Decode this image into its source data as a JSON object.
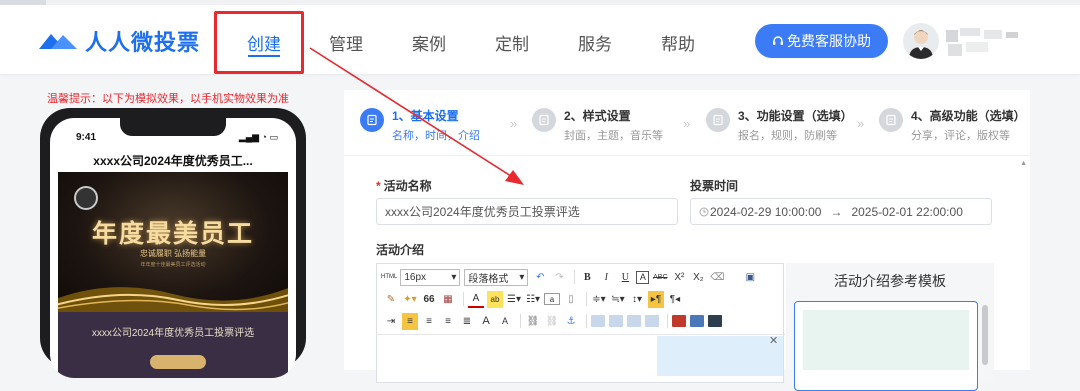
{
  "brand": {
    "logo_text": "人人微投票",
    "accent": "#1d6ff0"
  },
  "nav": [
    {
      "label": "创建",
      "active": true
    },
    {
      "label": "管理"
    },
    {
      "label": "案例"
    },
    {
      "label": "定制"
    },
    {
      "label": "服务"
    },
    {
      "label": "帮助"
    }
  ],
  "header": {
    "service_button": "免费客服协助",
    "avatar_icon": "person-avatar-icon"
  },
  "preview": {
    "tip": "温馨提示：以下为模拟效果，以手机实物效果为准",
    "time": "9:41",
    "status_icons": "▂▄▆ ◔ ▭",
    "title": "xxxx公司2024年度优秀员工...",
    "banner_title": "年度最美员工",
    "banner_sub": "忠诚履职  弘扬能量",
    "banner_tiny": "年年度十佳最美员工评选活动",
    "body_text": "xxxx公司2024年度优秀员工投票评选"
  },
  "steps": [
    {
      "title": "1、基本设置",
      "sub": "名称，时间，介绍",
      "active": true
    },
    {
      "title": "2、样式设置",
      "sub": "封面，主题，音乐等"
    },
    {
      "title": "3、功能设置（选填）",
      "sub": "报名，规则，防刷等"
    },
    {
      "title": "4、高级功能（选填）",
      "sub": "分享，评论，版权等"
    }
  ],
  "form": {
    "name_label": "活动名称",
    "name_value": "xxxx公司2024年度优秀员工投票评选",
    "time_label": "投票时间",
    "time_start": "2024-02-29 10:00:00",
    "time_arrow": "→",
    "time_end": "2025-02-01 22:00:00",
    "intro_label": "活动介绍"
  },
  "editor": {
    "html_label": "HTML",
    "font_size": "16px",
    "paragraph": "段落格式",
    "bold": "B",
    "italic": "I",
    "underline": "U",
    "a_box": "A",
    "strike": "ABC",
    "sup": "X²",
    "sub": "X₂",
    "quote": "66",
    "font_color": "A",
    "ab": "ab",
    "font_a1": "A",
    "font_a2": "A"
  },
  "templates": {
    "title": "活动介绍参考模板"
  }
}
